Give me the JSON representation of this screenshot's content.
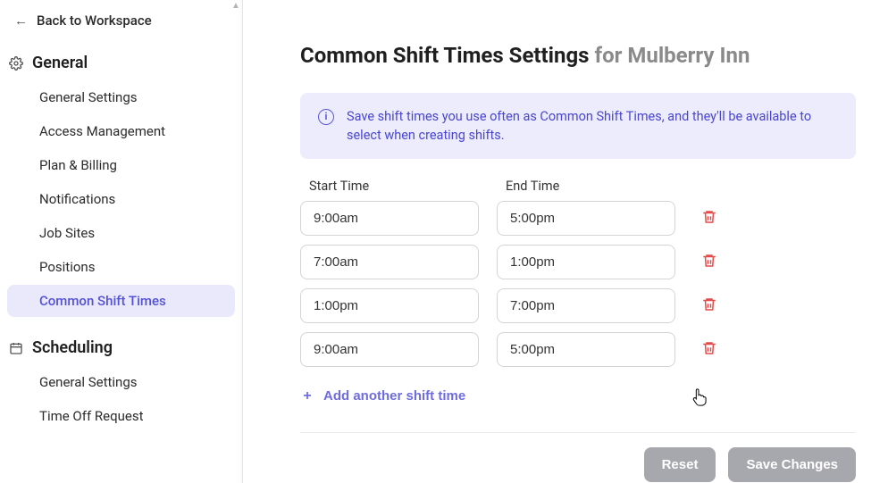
{
  "sidebar": {
    "back_label": "Back to Workspace",
    "sections": [
      {
        "title": "General",
        "icon": "gear-icon",
        "items": [
          {
            "label": "General Settings",
            "active": false
          },
          {
            "label": "Access Management",
            "active": false
          },
          {
            "label": "Plan & Billing",
            "active": false
          },
          {
            "label": "Notifications",
            "active": false
          },
          {
            "label": "Job Sites",
            "active": false
          },
          {
            "label": "Positions",
            "active": false
          },
          {
            "label": "Common Shift Times",
            "active": true
          }
        ]
      },
      {
        "title": "Scheduling",
        "icon": "calendar-icon",
        "items": [
          {
            "label": "General Settings",
            "active": false
          },
          {
            "label": "Time Off Request",
            "active": false
          }
        ]
      }
    ]
  },
  "page": {
    "title_main": "Common Shift Times Settings",
    "title_suffix": "for Mulberry Inn",
    "info_text": "Save shift times you use often as Common Shift Times, and they'll be available to select when creating shifts.",
    "col_start_label": "Start Time",
    "col_end_label": "End Time",
    "shift_rows": [
      {
        "start": "9:00am",
        "end": "5:00pm"
      },
      {
        "start": "7:00am",
        "end": "1:00pm"
      },
      {
        "start": "1:00pm",
        "end": "7:00pm"
      },
      {
        "start": "9:00am",
        "end": "5:00pm"
      }
    ],
    "add_label": "Add another shift time",
    "reset_label": "Reset",
    "save_label": "Save Changes"
  }
}
